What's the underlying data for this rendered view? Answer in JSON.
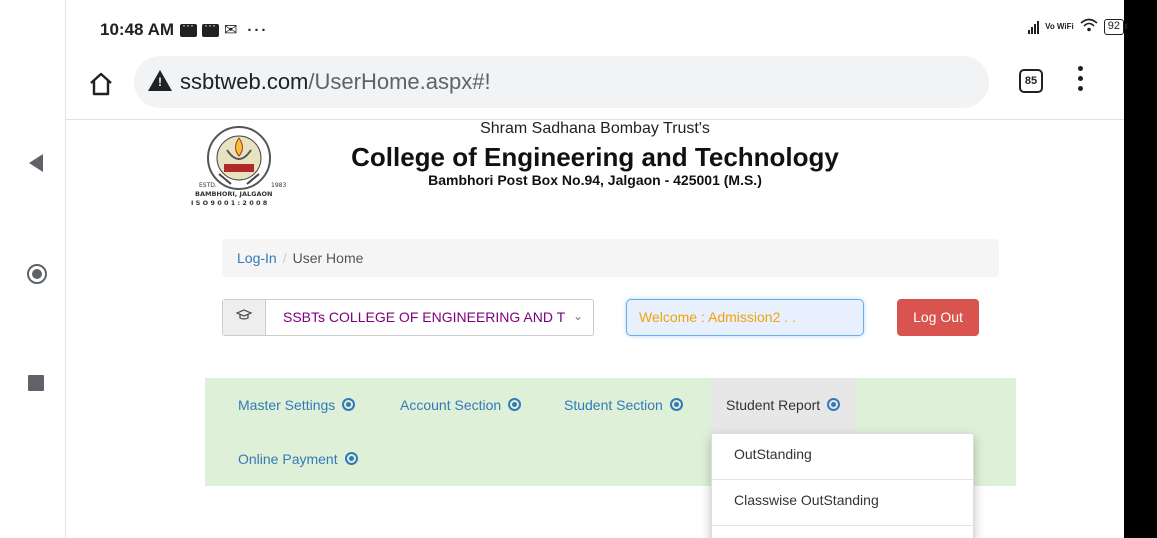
{
  "status": {
    "time": "10:48 AM",
    "battery": "92",
    "volte": "Vo WiFi"
  },
  "browser": {
    "url_host": "ssbtweb.com",
    "url_path": "/UserHome.aspx#!",
    "tab_count": "85"
  },
  "header": {
    "trust": "Shram Sadhana Bombay Trust's",
    "college": "College of Engineering and Technology",
    "address": "Bambhori Post Box No.94, Jalgaon - 425001 (M.S.)"
  },
  "breadcrumb": {
    "items": [
      "Log-In",
      "User Home"
    ],
    "separator": "/"
  },
  "college_select": {
    "value": "SSBTs COLLEGE OF ENGINEERING AND T"
  },
  "welcome": "Welcome : Admission2 . .",
  "logout_label": "Log Out",
  "menu": {
    "items": [
      {
        "label": "Master Settings"
      },
      {
        "label": "Account Section"
      },
      {
        "label": "Student Section"
      },
      {
        "label": "Student Report"
      },
      {
        "label": "Online Payment"
      }
    ]
  },
  "dropdown": {
    "items": [
      "OutStanding",
      "Classwise OutStanding"
    ]
  },
  "colors": {
    "menubar": "#dff0d8",
    "link": "#337ab7",
    "logout": "#d9534f",
    "welcome_text": "#f0a30a"
  }
}
